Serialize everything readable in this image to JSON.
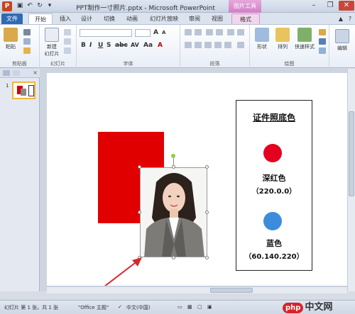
{
  "window": {
    "title": "PPT制作一寸照片.pptx - Microsoft PowerPoint",
    "contextual_tab_group": "图片工具",
    "app_icon_letter": "P"
  },
  "tabs": [
    "文件",
    "开始",
    "插入",
    "设计",
    "切换",
    "动画",
    "幻灯片放映",
    "审阅",
    "视图",
    "格式"
  ],
  "ribbon": {
    "clipboard": {
      "paste": "粘贴",
      "label": "剪贴板"
    },
    "slides": {
      "new_slide": "新建\n幻灯片",
      "label": "幻灯片"
    },
    "font": {
      "label": "字体"
    },
    "paragraph": {
      "label": "段落"
    },
    "drawing": {
      "shapes": "形状",
      "arrange": "排列",
      "quick_styles": "快速样式",
      "label": "绘图"
    },
    "editing": {
      "label": "编辑"
    }
  },
  "slide": {
    "card_title": "证件照底色",
    "colors": [
      {
        "name": "深红色",
        "value": "（220.0.0）",
        "hex": "#e4001f"
      },
      {
        "name": "蓝色",
        "value": "（60.140.220）",
        "hex": "#3c8cdc"
      }
    ],
    "thumb_number": "1"
  },
  "statusbar": {
    "slide_info": "幻灯片 第 1 张，共 1 张",
    "theme": "\"Office 主题\"",
    "language": "中文(中国)"
  },
  "watermark": {
    "logo": "php",
    "text": "中文网"
  }
}
